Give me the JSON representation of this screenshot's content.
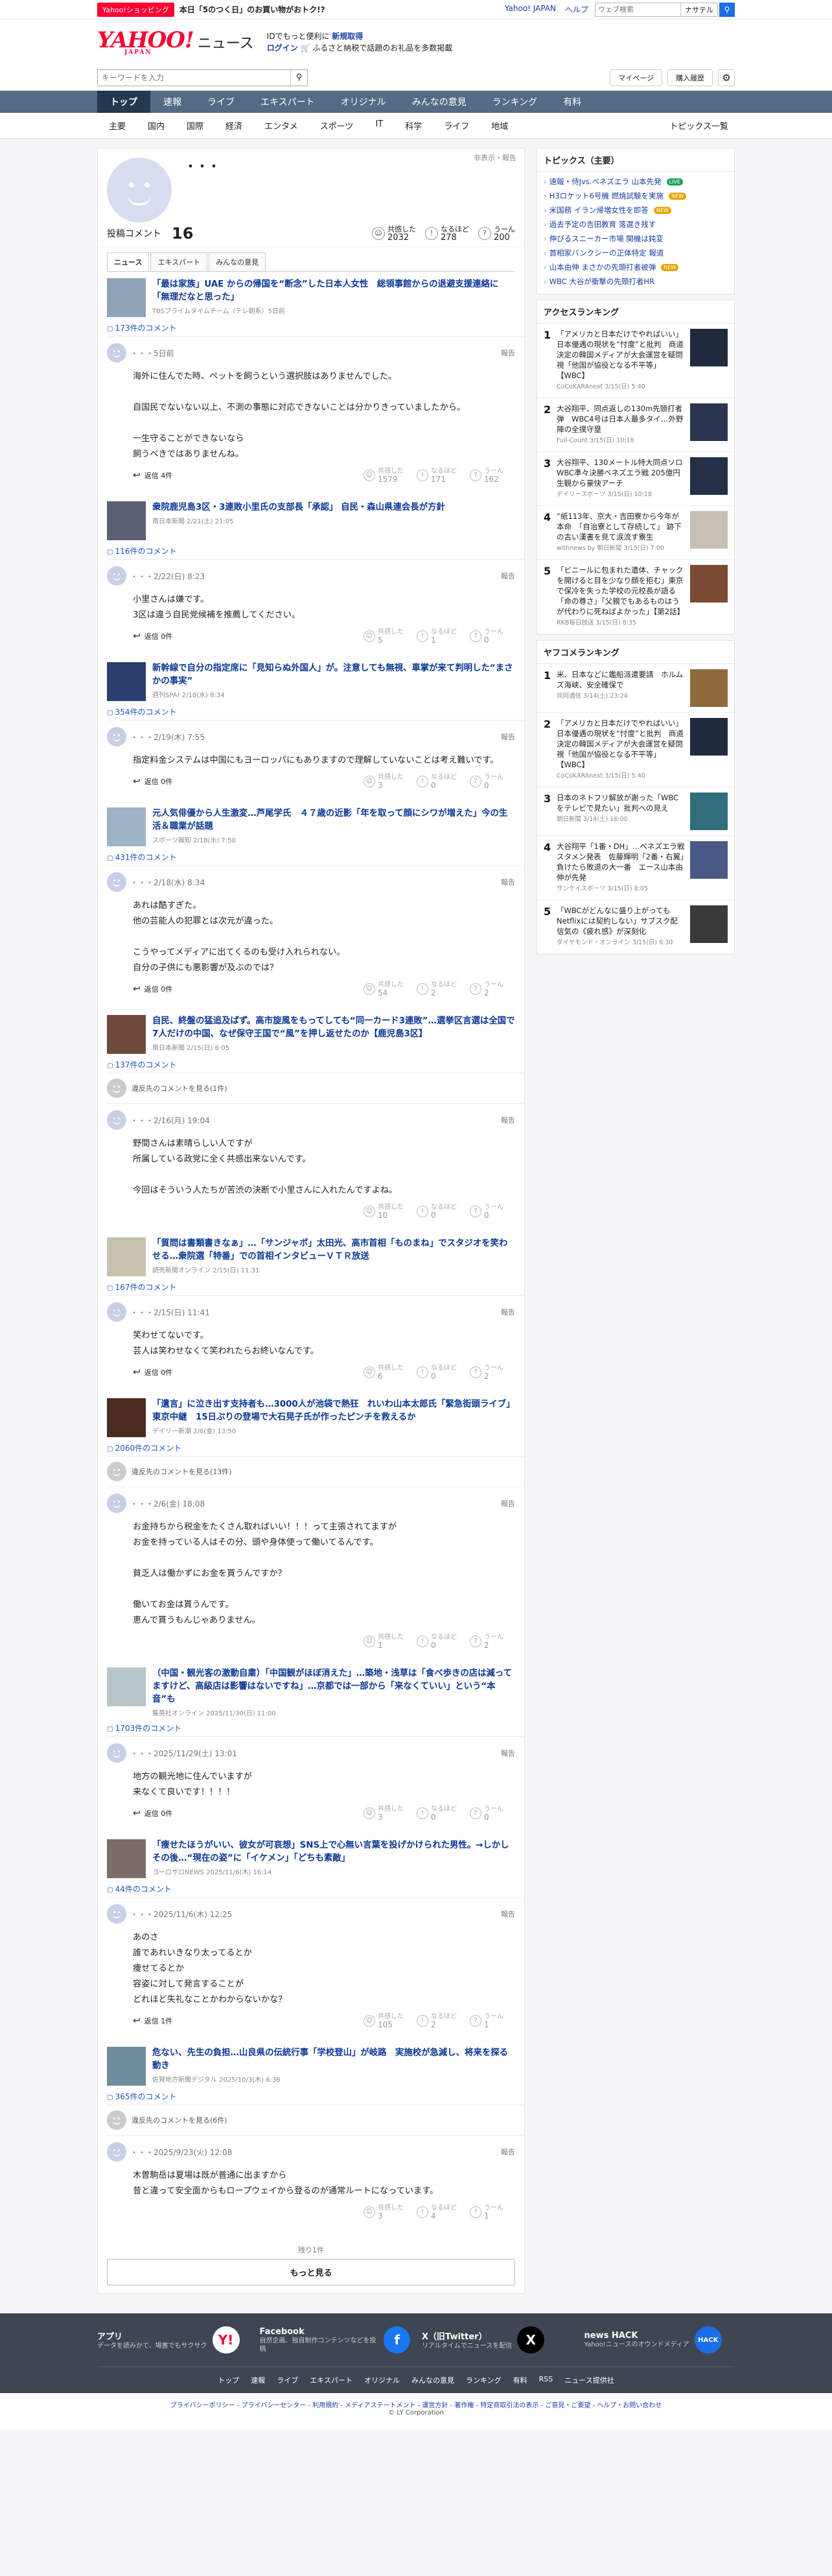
{
  "topbar": {
    "badge": "Yahoo!ショッピング",
    "promo": "本日「5のつく日」のお買い物がおトク!?",
    "links": [
      "Yahoo! JAPAN",
      "ヘルプ"
    ],
    "search_placeholder": "ウェブ検索",
    "navi": "ナサテル"
  },
  "brand": {
    "logo": "YAHOO!",
    "logo_sub": "JAPAN",
    "service": "ニュース",
    "info1a": "IDでもっと便利に",
    "info1b": "新規取得",
    "info2a": "ログイン",
    "info2b": "ふるさと納税で話題のお礼品を多数掲載"
  },
  "search": {
    "placeholder": "キーワードを入力",
    "mypage": "マイページ",
    "history": "購入履歴"
  },
  "catnav": [
    "トップ",
    "速報",
    "ライブ",
    "エキスパート",
    "オリジナル",
    "みんなの意見",
    "ランキング",
    "有料"
  ],
  "subnav": {
    "items": [
      "主要",
      "国内",
      "国際",
      "経済",
      "エンタメ",
      "スポーツ",
      "IT",
      "科学",
      "ライフ",
      "地域"
    ],
    "topics": "トピックス一覧"
  },
  "profile": {
    "name": "・・・",
    "report": "非表示・報告",
    "label": "投稿コメント",
    "count": "16",
    "reactions": [
      {
        "icon": "☺",
        "label": "共感した",
        "value": "2032"
      },
      {
        "icon": "!",
        "label": "なるほど",
        "value": "278"
      },
      {
        "icon": "?",
        "label": "うーん",
        "value": "200"
      }
    ]
  },
  "tabs": [
    "ニュース",
    "エキスパート",
    "みんなの意見"
  ],
  "common": {
    "reply": "返信",
    "report": "報告",
    "hidden": "違反先のコメントを見る",
    "r1": "共感した",
    "r2": "なるほど",
    "r3": "うーん"
  },
  "articles": [
    {
      "title": "「最は家族」UAE からの帰国を“断念”した日本人女性　総領事館からの退避支援連絡に「無理だなと思った」",
      "source": "TBSプライムタイムチーム（テレ朝系）5日前",
      "count": "173件のコメント",
      "comments": [
        {
          "date": "・・・5日前",
          "body": "海外に住んでた時、ペットを飼うという選択肢はありませんでした。\n\n自国民でないない以上、不測の事態に対応できないことは分かりきっていましたから。\n\n一生守ることができないなら\n飼うべきではありませんね。",
          "replies": "返信 4件",
          "r": [
            "1579",
            "171",
            "162"
          ]
        }
      ]
    },
    {
      "title": "衆院鹿児島3区・3連敗小里氏の支部長「承認」 自民・森山県連会長が方針",
      "source": "南日本新聞 2/21(土) 21:05",
      "count": "116件のコメント",
      "comments": [
        {
          "date": "・・・2/22(日) 8:23",
          "body": "小里さんは嫌です。\n3区は違う自民党候補を推薦してください。",
          "replies": "返信 0件",
          "r": [
            "5",
            "1",
            "0"
          ]
        }
      ]
    },
    {
      "title": "新幹線で自分の指定席に「見知らぬ外国人」が。注意しても無視、車掌が来て判明した“まさかの事実”",
      "source": "週刊SPA! 2/18(水) 8:34",
      "count": "354件のコメント",
      "comments": [
        {
          "date": "・・・2/19(木) 7:55",
          "body": "指定料金システムは中国にもヨーロッパにもありますので理解していないことは考え難いです。",
          "replies": "返信 0件",
          "r": [
            "3",
            "0",
            "0"
          ]
        }
      ]
    },
    {
      "title": "元人気俳優から人生激変…芦尾学氏　４７歳の近影「年を取って顔にシワが増えた」今の生活＆職業が話題",
      "source": "スポーツ報知 2/18(水) 7:50",
      "count": "431件のコメント",
      "comments": [
        {
          "date": "・・・2/18(水) 8:34",
          "body": "あれは酷すぎた。\n他の芸能人の犯罪とは次元が違った。\n\nこうやってメディアに出てくるのも受け入れられない。\n自分の子供にも悪影響が及ぶのでは？",
          "replies": "返信 0件",
          "r": [
            "54",
            "2",
            "2"
          ]
        }
      ]
    },
    {
      "title": "自民、終盤の猛追及ばず。高市旋風をもってしても“同一カード3連敗”…選挙区言選は全国で7人だけの中国、なぜ保守王国で“風”を押し返せたのか【鹿児島3区】",
      "source": "南日本新聞 2/15(日) 6:05",
      "count": "137件のコメント",
      "hidden": "違反先のコメントを見る(1件)",
      "comments": [
        {
          "date": "・・・2/16(月) 19:04",
          "body": "野間さんは素晴らしい人ですが\n所属している政党に全く共感出来ないんです。\n\n今回はそういう人たちが苦渋の決断で小里さんに入れたんですよね。",
          "replies": "",
          "r": [
            "10",
            "0",
            "0"
          ]
        }
      ]
    },
    {
      "title": "「質問は書類書きなぁ」…「サンジャポ」太田光、高市首相「ものまね」でスタジオを笑わせる…衆院選「特番」での首相インタビューＶＴＲ放送",
      "source": "読売新聞オンライン 2/15(日) 11:31",
      "count": "167件のコメント",
      "comments": [
        {
          "date": "・・・2/15(日) 11:41",
          "body": "笑わせてないです。\n芸人は笑わせなくて笑われたらお終いなんです。",
          "replies": "返信 0件",
          "r": [
            "6",
            "0",
            "2"
          ]
        }
      ]
    },
    {
      "title": "「遺言」に泣き出す支持者も…3000人が池袋で熱狂　れいわ山本太郎氏「緊急街頭ライブ」東京中継　15日ぶりの登場で大石晃子氏が作ったピンチを救えるか",
      "source": "デイリー新潮 2/6(金) 13:50",
      "count": "2060件のコメント",
      "hidden": "違反先のコメントを見る(13件)",
      "comments": [
        {
          "date": "・・・2/6(金) 18:08",
          "body": "お金持ちから税金をたくさん取ればいい！！！って主張されてますが\nお金を持っている人はその分、頭や身体使って働いてるんです。\n\n貧乏人は働かずにお金を貰うんですか？\n\n働いてお金は貰うんです。\n恵んで貰うもんじゃありません。",
          "replies": "",
          "r": [
            "1",
            "0",
            "2"
          ]
        }
      ]
    },
    {
      "title": "（中国・観光客の激動自粛）「中国観がほぼ消えた」…築地・浅草は「食べ歩きの店は減ってますけど、高級店は影響はないですね」…京都では一部から「来なくていい」という“本音”も",
      "source": "集英社オンライン 2025/11/30(日) 11:00",
      "count": "1703件のコメント",
      "comments": [
        {
          "date": "・・・2025/11/29(土) 13:01",
          "body": "地方の観光地に住んでいますが\n来なくて良いです！！！！",
          "replies": "返信 0件",
          "r": [
            "3",
            "0",
            "0"
          ]
        }
      ]
    },
    {
      "title": "「痩せたほうがいい、彼女が可哀想」SNS上で心無い言葉を投げかけられた男性。→しかしその後…“現在の姿”に「イケメン」「どちも素敵」",
      "source": "ヨーロサロNEWS 2025/11/6(木) 16:14",
      "count": "44件のコメント",
      "comments": [
        {
          "date": "・・・2025/11/6(木) 12:25",
          "body": "あのさ\n誰であれいきなり太ってるとか\n痩せてるとか\n容姿に対して発言することが\nどれほど失礼なことかわからないかな？",
          "replies": "返信 1件",
          "r": [
            "105",
            "2",
            "1"
          ]
        }
      ]
    },
    {
      "title": "危ない、先生の負担…山良県の伝統行事「学校登山」が岐路　実施校が急減し、将来を探る動き",
      "source": "佐賀地方新聞デジタル 2025/10/3(木) 6:36",
      "count": "365件のコメント",
      "hidden": "違反先のコメントを見る(6件)",
      "comments": [
        {
          "date": "・・・2025/9/23(火) 12:08",
          "body": "木曽駒岳は夏場は既が普通に出ますから\n昔と違って安全面からもロープウェイから登るのが通常ルートになっています。",
          "replies": "",
          "r": [
            "3",
            "4",
            "1"
          ]
        }
      ]
    }
  ],
  "paging": {
    "count": "残り1件",
    "more": "もっと見る"
  },
  "side": {
    "topics_title": "トピックス（主要）",
    "topics": [
      {
        "t": "速報・侍Jvs.ベネズエラ 山本先発",
        "tag": "LIVE",
        "c": "#1aa260"
      },
      {
        "t": "H3ロケット6号機 燃焼試験を実施",
        "tag": "NEW",
        "c": "#e8a400"
      },
      {
        "t": "米国務 イラン帰増女性を即答",
        "tag": "NEW",
        "c": "#e8a400"
      },
      {
        "t": "過去予定の吉田教育 落選き残す",
        "tag": "",
        "c": ""
      },
      {
        "t": "伸びるスニーカー市場 関機は鈍変",
        "tag": "",
        "c": ""
      },
      {
        "t": "首相家バンクシーの正体特定 報道",
        "tag": "",
        "c": ""
      },
      {
        "t": "山本由伸 まさかの先頭打者被弾",
        "tag": "NEW",
        "c": "#e8a400"
      },
      {
        "t": "WBC 大谷が衝撃の先頭打者HR",
        "tag": "",
        "c": ""
      }
    ],
    "access_title": "アクセスランキング",
    "access": [
      {
        "n": "1",
        "t": "「アメリカと日本だけでやればいい」日本優遇の現状を“忖度”と批判　商道決定の韓国メディアが大会運営を疑問視「他国が協役となる不平等」【WBC】",
        "s": "CoCoKARAnext 3/15(日) 5:40",
        "c": "#1f2a3f"
      },
      {
        "n": "2",
        "t": "大谷翔平、同点返しの130m先頭打者弾　WBC4号は日本人最多タイ…外野陣の全撲守塁",
        "s": "Full-Count 3/15(日) 10:18",
        "c": "#2a3650"
      },
      {
        "n": "3",
        "t": "大谷翔平、130メートル特大同点ソロ　WBC準々決勝ベネズエラ戦 205億円生観から豪快アーチ",
        "s": "デイリースポーツ 3/15(日) 10:18",
        "c": "#233048"
      },
      {
        "n": "4",
        "t": "“紙113年、京大・吉田寮から今年が本命　「自治寮として存続して」 跡下の古い漢書を見て涙流す寮生",
        "s": "withnews by 朝日新聞 3/15(日) 7:00",
        "c": "#c7bfb4"
      },
      {
        "n": "5",
        "t": "「ビニールに包まれた遺体、チャックを開けると目を少なり顔を拒む」東京で保冷を失った学校の元校長が語る「命の尊さ」「父親でもあるものはうが代わりに死ねばよかった」【第2話】",
        "s": "RKB毎日放送 3/15(日) 8:35",
        "c": "#7a4a32"
      }
    ],
    "yafuko_title": "ヤフコメランキング",
    "yafuko": [
      {
        "n": "1",
        "t": "米、日本などに鑑船派遣要請　ホルムズ海峡、安全確保で",
        "s": "共同通信 3/14(土) 23:24",
        "c": "#8f6a3a"
      },
      {
        "n": "2",
        "t": "「アメリカと日本だけでやればいい」日本優遇の現状を“忖度”と批判　商道決定の韓国メディアが大会運営を疑問視「他国が協役となる不平等」【WBC】",
        "s": "CoCoKARAnext 3/15(日) 5:40",
        "c": "#1f2a3f"
      },
      {
        "n": "3",
        "t": "日本のネトフリ解放が謝った「WBCをテレビで見たい」批判への見え",
        "s": "朝日新聞 3/14(土) 16:00",
        "c": "#2f6e7a"
      },
      {
        "n": "4",
        "t": "大谷翔平「1番・DH」…ベネズエラ戦スタメン発表　佐藤輝明「2番・右翼」　負けたら敗退の大一番　エース山本由伸が先発",
        "s": "サンケイスポーツ 3/15(日) 8:05",
        "c": "#4a5a86"
      },
      {
        "n": "5",
        "t": "「WBCがどんなに盛り上がってもNetflixには契約しない」サブスク配信気の《疲れ感》が深刻化",
        "s": "ダイヤモンド・オンライン 3/15(日) 6:30",
        "c": "#3a3a3a"
      }
    ]
  },
  "footer": {
    "apps": [
      {
        "h": "アプリ",
        "p": "データを読みかて、場書でもサクサク",
        "ico": "Y!",
        "c": "#fff",
        "fc": "#ff0033"
      },
      {
        "h": "Facebook",
        "p": "自然企画、独自制作コンテンツなどを投稿",
        "ico": "f",
        "c": "#1877f2",
        "fc": "#fff"
      },
      {
        "h": "X（旧Twitter）",
        "p": "リアルタイムでニュースを配信",
        "ico": "X",
        "c": "#000",
        "fc": "#fff"
      },
      {
        "h": "news HACK",
        "p": "Yahoo!ニュースのオウンドメディア",
        "ico": "HACK",
        "c": "#1a6fe8",
        "fc": "#fff"
      }
    ],
    "links": [
      "トップ",
      "速報",
      "ライブ",
      "エキスパート",
      "オリジナル",
      "みんなの意見",
      "ランキング",
      "有料",
      "RSS",
      "ニュース提供社"
    ],
    "legal": "プライバシーポリシー - プライバシーセンター - 利用規約 - メディアステートメント - 運営方針 - 著作権 - 特定商取引法の表示 - ご意見・ご要望 - ヘルプ・お問い合わせ",
    "copy": "© LY Corporation"
  }
}
